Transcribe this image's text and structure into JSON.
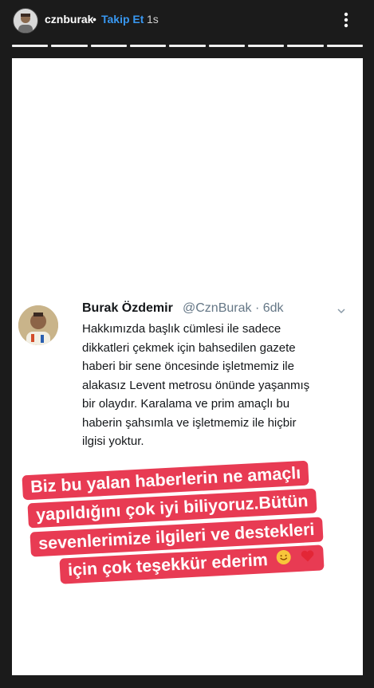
{
  "header": {
    "username": "cznburak",
    "separator": "•",
    "follow_label": "Takip Et",
    "time": "1s",
    "avatar_icon": "profile-avatar",
    "more_icon": "more-vertical-icon"
  },
  "story": {
    "progress_segments": 9,
    "progress_color": "#f0f0f0"
  },
  "tweet": {
    "name": "Burak Özdemir",
    "handle": "@CznBurak · 6dk",
    "body": "Hakkımızda başlık cümlesi ile sadece\ndikkatleri çekmek için bahsedilen gazete\nhaberi bir sene öncesinde işletmemiz ile\nalakasız Levent metrosu önünde yaşanmış\nbir olaydır. Karalama ve prim amaçlı bu\nhaberin şahsımla ve işletmemiz ile hiçbir\nilgisi yoktur.",
    "chevron_icon": "chevron-down-icon"
  },
  "sticker": {
    "lines": [
      "Biz bu yalan haberlerin ne amaçlı",
      "yapıldığını çok iyi biliyoruz.Bütün",
      "sevenlerimize ilgileri ve destekleri",
      "için çok teşekkür ederim"
    ],
    "background_color": "#e83b53",
    "emoji_icons": [
      "smiling-hug-emoji",
      "red-heart-emoji"
    ]
  }
}
